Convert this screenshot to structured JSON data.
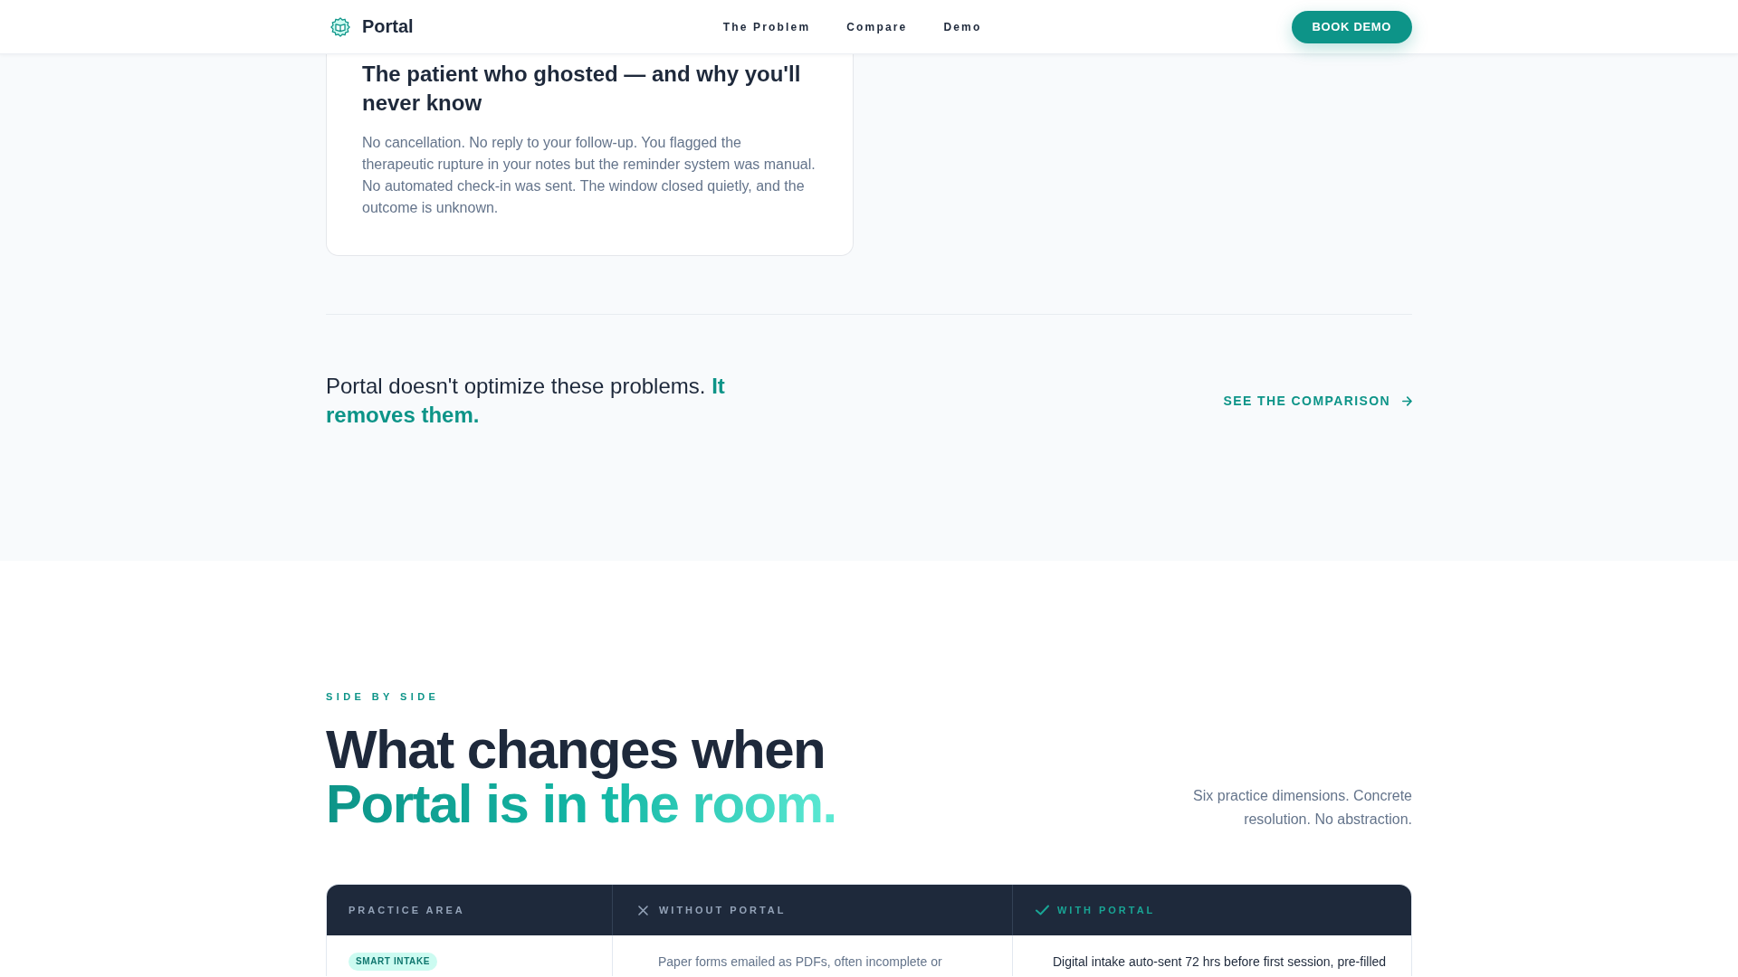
{
  "header": {
    "brand": "Portal",
    "nav": [
      "The Problem",
      "Compare",
      "Demo"
    ],
    "cta": "BOOK DEMO"
  },
  "problem_card": {
    "title": "The patient who ghosted — and why you'll never know",
    "body": "No cancellation. No reply to your follow-up. You flagged the therapeutic rupture in your notes but the reminder system was manual. No automated check-in was sent. The window closed quietly, and the outcome is unknown."
  },
  "callout": {
    "text": "Portal doesn't optimize these problems. **It removes them.**",
    "link": "SEE THE COMPARISON"
  },
  "comparison": {
    "eyebrow": "SIDE BY SIDE",
    "title_line_1": "What changes when",
    "title_line_2": "Portal is in the room.",
    "intro": "Six practice dimensions. Concrete resolution. No abstraction.",
    "table": {
      "columns": [
        {
          "label": "PRACTICE AREA",
          "kind": "plain"
        },
        {
          "label": "WITHOUT PORTAL",
          "kind": "without"
        },
        {
          "label": "WITH PORTAL",
          "kind": "with"
        }
      ],
      "rows": [
        {
          "practice_area": "SMART INTAKE",
          "without_portal": "Paper forms emailed as PDFs, often incomplete or",
          "with_portal": "Digital intake auto-sent 72 hrs before first session, pre-filled"
        }
      ]
    }
  }
}
